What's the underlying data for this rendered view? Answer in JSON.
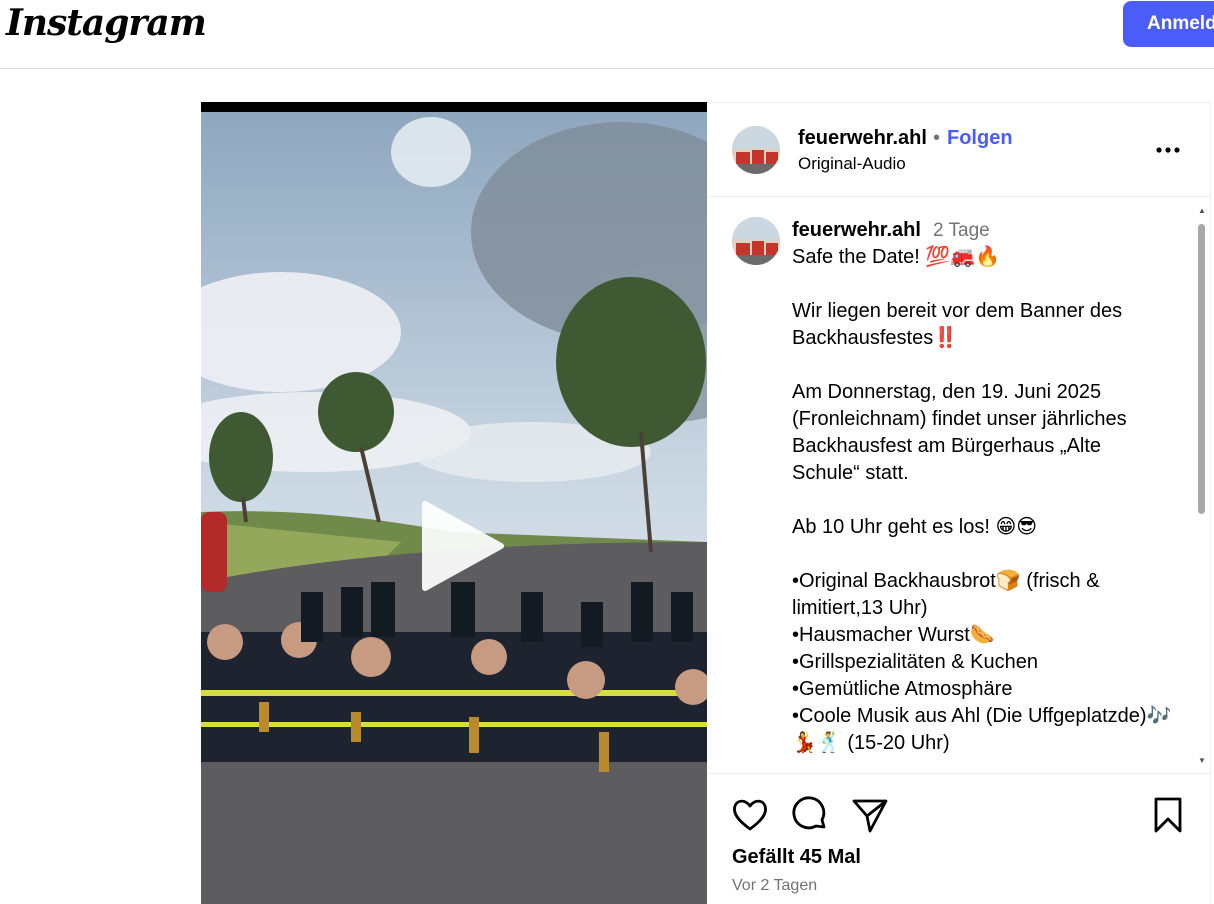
{
  "app": {
    "logo_text": "Instagram",
    "login_label": "Anmelden"
  },
  "header": {
    "username": "feuerwehr.ahl",
    "separator": "•",
    "follow_label": "Folgen",
    "audio": "Original-Audio",
    "more_icon": "more-horizontal-icon"
  },
  "comment": {
    "username": "feuerwehr.ahl",
    "time": "2 Tage",
    "caption": {
      "line1": "Safe the Date! 💯🚒🔥",
      "para2": "Wir liegen bereit vor dem Banner des Backhausfestes‼️",
      "para3": "Am Donnerstag, den 19. Juni 2025 (Fronleichnam) findet unser jährliches Backhausfest am Bürgerhaus „Alte Schule“ statt.",
      "para4": "Ab 10 Uhr geht es los! 😁😎",
      "items": [
        "•Original Backhausbrot🍞 (frisch & limitiert,13 Uhr)",
        "•Hausmacher Wurst🌭",
        "•Grillspezialitäten & Kuchen",
        "•Gemütliche Atmosphäre",
        "•Coole Musik aus Ahl (Die Uffgeplatzde)🎶💃🕺 (15-20 Uhr)"
      ]
    }
  },
  "actions": {
    "like_icon": "heart-icon",
    "comment_icon": "comment-icon",
    "share_icon": "share-icon",
    "save_icon": "bookmark-icon"
  },
  "likes": "Gefällt 45 Mal",
  "date": "Vor 2 Tagen",
  "video": {
    "play_icon": "play-icon"
  },
  "colors": {
    "accent": "#4a5df9",
    "muted": "#737373",
    "border": "#dbdbdb"
  }
}
